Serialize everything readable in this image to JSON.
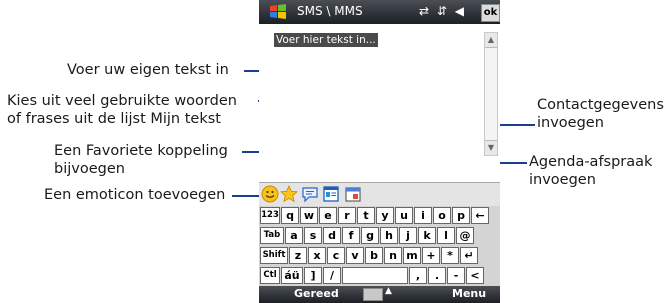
{
  "phone": {
    "title": "SMS \\ MMS",
    "ok_label": "ok",
    "status_icons": "⇄ ⇵ ◀",
    "placeholder": "Voer hier tekst in..."
  },
  "callouts": {
    "own_text": "Voer uw eigen tekst in",
    "my_text_1": "Kies uit veel gebruikte woorden",
    "my_text_2": "of frases uit de lijst Mijn tekst",
    "favorite_1": "Een Favoriete koppeling",
    "favorite_2": "bijvoegen",
    "emoticon": "Een emoticon toevoegen",
    "contact_1": "Contactgegevens",
    "contact_2": "invoegen",
    "agenda_1": "Agenda-afspraak",
    "agenda_2": "invoegen"
  },
  "toolbar_icons": [
    "emoticon-icon",
    "favorite-star-icon",
    "my-text-icon",
    "contact-card-icon",
    "calendar-icon"
  ],
  "keyboard": {
    "rows": [
      [
        "123",
        "q",
        "w",
        "e",
        "r",
        "t",
        "y",
        "u",
        "i",
        "o",
        "p",
        "←"
      ],
      [
        "Tab",
        "a",
        "s",
        "d",
        "f",
        "g",
        "h",
        "j",
        "k",
        "l",
        "@"
      ],
      [
        "Shift",
        "z",
        "x",
        "c",
        "v",
        "b",
        "n",
        "m",
        "+",
        "*",
        "↵"
      ],
      [
        "Ctl",
        "áü",
        "]",
        "/",
        "",
        ",",
        ".",
        "-",
        "<"
      ]
    ]
  },
  "softkeys": {
    "left": "Gereed",
    "right": "Menu"
  }
}
